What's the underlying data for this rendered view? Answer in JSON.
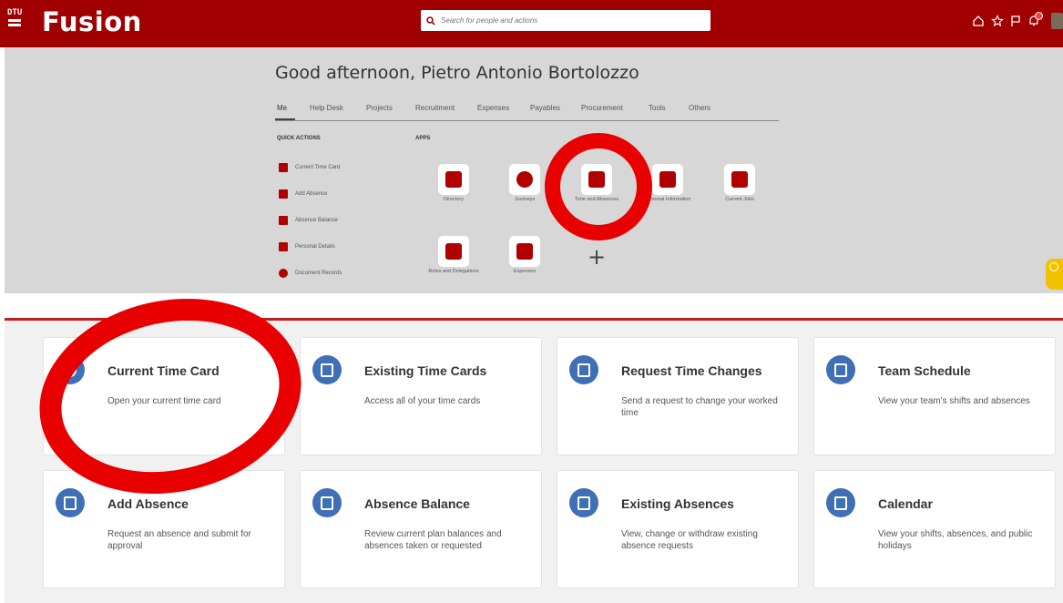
{
  "header": {
    "logo_text": "DTU",
    "brand": "Fusion",
    "search_placeholder": "Search for people and actions",
    "colors": {
      "brand_red": "#a00000",
      "accent_blue": "#3f6fb4",
      "annotation_red": "#e80000"
    }
  },
  "springboard": {
    "greeting": "Good afternoon, Pietro Antonio Bortolozzo",
    "tabs": [
      "Me",
      "Help Desk",
      "Projects",
      "Recruitment",
      "Expenses",
      "Payables",
      "Procurement",
      "Tools",
      "Others"
    ],
    "active_tab": "Me",
    "quick_actions_label": "QUICK ACTIONS",
    "quick_actions": [
      "Current Time Card",
      "Add Absence",
      "Absence Balance",
      "Personal Details",
      "Document Records"
    ],
    "apps_label": "APPS",
    "apps": [
      {
        "label": "Directory",
        "icon": "org-chart-icon"
      },
      {
        "label": "Journeys",
        "icon": "compass-icon"
      },
      {
        "label": "Time and Absences",
        "icon": "calendar-icon"
      },
      {
        "label": "Personal Information",
        "icon": "person-icon"
      },
      {
        "label": "Current Jobs",
        "icon": "briefcase-icon"
      },
      {
        "label": "Roles and Delegations",
        "icon": "badge-icon"
      },
      {
        "label": "Expenses",
        "icon": "wallet-icon"
      }
    ],
    "add_symbol": "+"
  },
  "cards": [
    {
      "title": "Current Time Card",
      "desc": "Open your current time card",
      "icon": "clock-icon"
    },
    {
      "title": "Existing Time Cards",
      "desc": "Access all of your time cards",
      "icon": "document-stack-icon"
    },
    {
      "title": "Request Time Changes",
      "desc": "Send a request to change your worked time",
      "icon": "edit-icon"
    },
    {
      "title": "Team Schedule",
      "desc": "View your team's shifts and absences",
      "icon": "schedule-icon"
    },
    {
      "title": "Add Absence",
      "desc": "Request an absence and submit for approval",
      "icon": "calendar-edit-icon"
    },
    {
      "title": "Absence Balance",
      "desc": "Review current plan balances and absences taken or requested",
      "icon": "calculator-icon"
    },
    {
      "title": "Existing Absences",
      "desc": "View, change or withdraw existing absence requests",
      "icon": "calendar-clock-icon"
    },
    {
      "title": "Calendar",
      "desc": "View your shifts, absences, and public holidays",
      "icon": "calendar-grid-icon"
    }
  ]
}
